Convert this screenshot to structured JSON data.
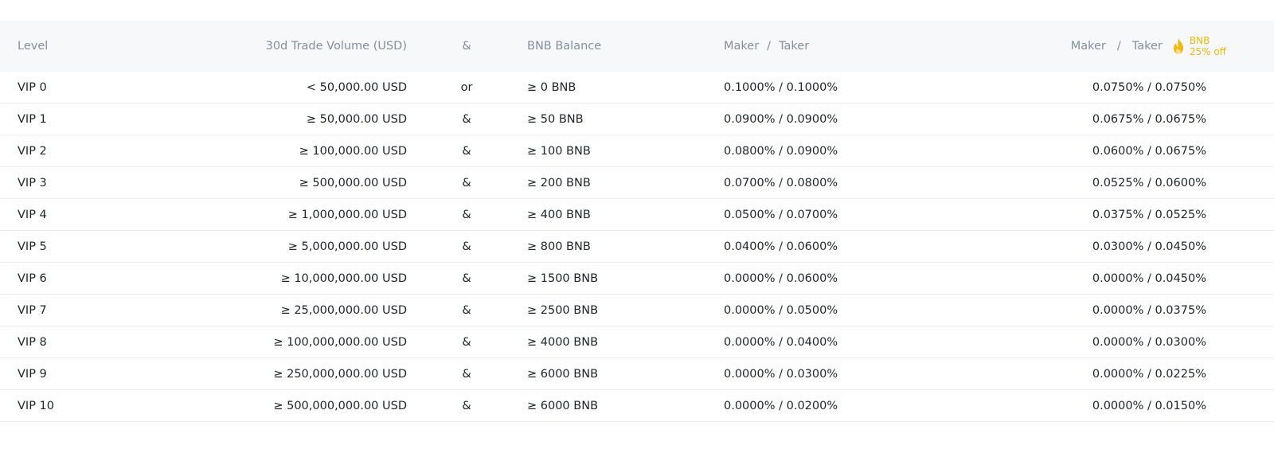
{
  "header": {
    "level": "Level",
    "volume": "30d Trade Volume (USD)",
    "connector": "&",
    "bnb_balance": "BNB Balance",
    "maker_taker": {
      "maker": "Maker",
      "sep": "/",
      "taker": "Taker"
    },
    "discount": {
      "maker": "Maker",
      "sep": "/",
      "taker": "Taker",
      "icon": "fire-icon",
      "promo_line1": "BNB",
      "promo_line2": "25% off"
    }
  },
  "colors": {
    "header_bg": "#f7f8fa",
    "header_text": "#848e9c",
    "body_text": "#1e2329",
    "row_divider": "#eaecef",
    "accent": "#f0b90b"
  },
  "rows": [
    {
      "level": "VIP 0",
      "volume": "< 50,000.00 USD",
      "connector": "or",
      "bnb": "≥ 0 BNB",
      "maker_taker": "0.1000% / 0.1000%",
      "discount": "0.0750% / 0.0750%"
    },
    {
      "level": "VIP 1",
      "volume": "≥ 50,000.00 USD",
      "connector": "&",
      "bnb": "≥ 50 BNB",
      "maker_taker": "0.0900% / 0.0900%",
      "discount": "0.0675% / 0.0675%"
    },
    {
      "level": "VIP 2",
      "volume": "≥ 100,000.00 USD",
      "connector": "&",
      "bnb": "≥ 100 BNB",
      "maker_taker": "0.0800% / 0.0900%",
      "discount": "0.0600% / 0.0675%"
    },
    {
      "level": "VIP 3",
      "volume": "≥ 500,000.00 USD",
      "connector": "&",
      "bnb": "≥ 200 BNB",
      "maker_taker": "0.0700% / 0.0800%",
      "discount": "0.0525% / 0.0600%"
    },
    {
      "level": "VIP 4",
      "volume": "≥ 1,000,000.00 USD",
      "connector": "&",
      "bnb": "≥ 400 BNB",
      "maker_taker": "0.0500% / 0.0700%",
      "discount": "0.0375% / 0.0525%"
    },
    {
      "level": "VIP 5",
      "volume": "≥ 5,000,000.00 USD",
      "connector": "&",
      "bnb": "≥ 800 BNB",
      "maker_taker": "0.0400% / 0.0600%",
      "discount": "0.0300% / 0.0450%"
    },
    {
      "level": "VIP 6",
      "volume": "≥ 10,000,000.00 USD",
      "connector": "&",
      "bnb": "≥ 1500 BNB",
      "maker_taker": "0.0000% / 0.0600%",
      "discount": "0.0000% / 0.0450%"
    },
    {
      "level": "VIP 7",
      "volume": "≥ 25,000,000.00 USD",
      "connector": "&",
      "bnb": "≥ 2500 BNB",
      "maker_taker": "0.0000% / 0.0500%",
      "discount": "0.0000% / 0.0375%"
    },
    {
      "level": "VIP 8",
      "volume": "≥ 100,000,000.00 USD",
      "connector": "&",
      "bnb": "≥ 4000 BNB",
      "maker_taker": "0.0000% / 0.0400%",
      "discount": "0.0000% / 0.0300%"
    },
    {
      "level": "VIP 9",
      "volume": "≥ 250,000,000.00 USD",
      "connector": "&",
      "bnb": "≥ 6000 BNB",
      "maker_taker": "0.0000% / 0.0300%",
      "discount": "0.0000% / 0.0225%"
    },
    {
      "level": "VIP 10",
      "volume": "≥ 500,000,000.00 USD",
      "connector": "&",
      "bnb": "≥ 6000 BNB",
      "maker_taker": "0.0000% / 0.0200%",
      "discount": "0.0000% / 0.0150%"
    }
  ]
}
